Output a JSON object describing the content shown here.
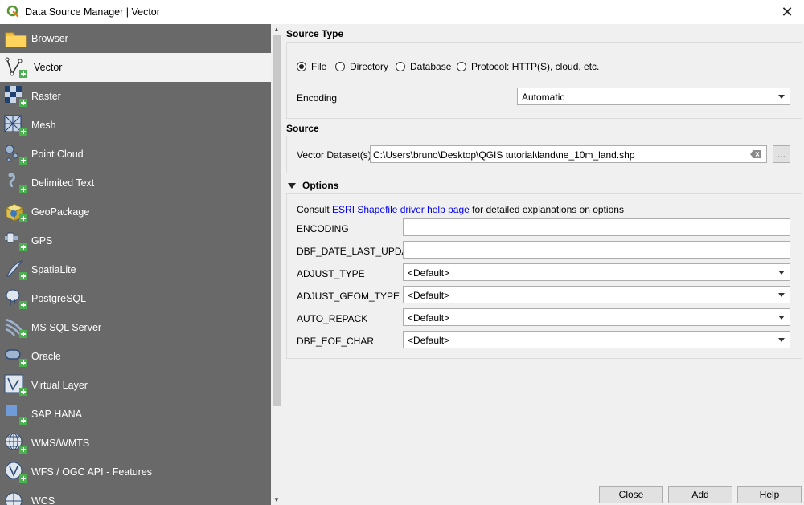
{
  "window": {
    "title": "Data Source Manager | Vector",
    "close_glyph": "✕"
  },
  "sidebar": {
    "items": [
      {
        "label": "Browser",
        "icon": "folder-icon"
      },
      {
        "label": "Vector",
        "icon": "vector-layer-icon",
        "selected": true
      },
      {
        "label": "Raster",
        "icon": "raster-layer-icon"
      },
      {
        "label": "Mesh",
        "icon": "mesh-layer-icon"
      },
      {
        "label": "Point Cloud",
        "icon": "point-cloud-icon"
      },
      {
        "label": "Delimited Text",
        "icon": "delimited-text-icon"
      },
      {
        "label": "GeoPackage",
        "icon": "geopackage-icon"
      },
      {
        "label": "GPS",
        "icon": "gps-icon"
      },
      {
        "label": "SpatiaLite",
        "icon": "spatialite-icon"
      },
      {
        "label": "PostgreSQL",
        "icon": "postgresql-icon"
      },
      {
        "label": "MS SQL Server",
        "icon": "mssql-icon"
      },
      {
        "label": "Oracle",
        "icon": "oracle-icon"
      },
      {
        "label": "Virtual Layer",
        "icon": "virtual-layer-icon"
      },
      {
        "label": "SAP HANA",
        "icon": "sap-hana-icon"
      },
      {
        "label": "WMS/WMTS",
        "icon": "wms-icon"
      },
      {
        "label": "WFS / OGC API - Features",
        "icon": "wfs-icon"
      },
      {
        "label": "WCS",
        "icon": "wcs-icon"
      }
    ]
  },
  "source_type": {
    "title": "Source Type",
    "options": [
      {
        "label": "File",
        "checked": true
      },
      {
        "label": "Directory",
        "checked": false
      },
      {
        "label": "Database",
        "checked": false
      },
      {
        "label": "Protocol: HTTP(S), cloud, etc.",
        "checked": false
      }
    ],
    "encoding_label": "Encoding",
    "encoding_value": "Automatic"
  },
  "source": {
    "title": "Source",
    "dataset_label": "Vector Dataset(s)",
    "dataset_value": "C:\\Users\\bruno\\Desktop\\QGIS tutorial\\land\\ne_10m_land.shp",
    "browse_label": "..."
  },
  "options": {
    "title": "Options",
    "consult_prefix": "Consult ",
    "consult_link": "ESRI Shapefile driver help page",
    "consult_suffix": " for detailed explanations on options",
    "rows": [
      {
        "label": "ENCODING",
        "type": "text",
        "value": ""
      },
      {
        "label": "DBF_DATE_LAST_UPDATE",
        "type": "text",
        "value": ""
      },
      {
        "label": "ADJUST_TYPE",
        "type": "combo",
        "value": "<Default>"
      },
      {
        "label": "ADJUST_GEOM_TYPE",
        "type": "combo",
        "value": "<Default>"
      },
      {
        "label": "AUTO_REPACK",
        "type": "combo",
        "value": "<Default>"
      },
      {
        "label": "DBF_EOF_CHAR",
        "type": "combo",
        "value": "<Default>"
      }
    ]
  },
  "buttons": {
    "close": "Close",
    "add": "Add",
    "help": "Help"
  },
  "colors": {
    "sidebar_bg": "#696969",
    "selected_bg": "#f2f2f2",
    "link": "#0000ee",
    "qgis_green": "#589632"
  }
}
